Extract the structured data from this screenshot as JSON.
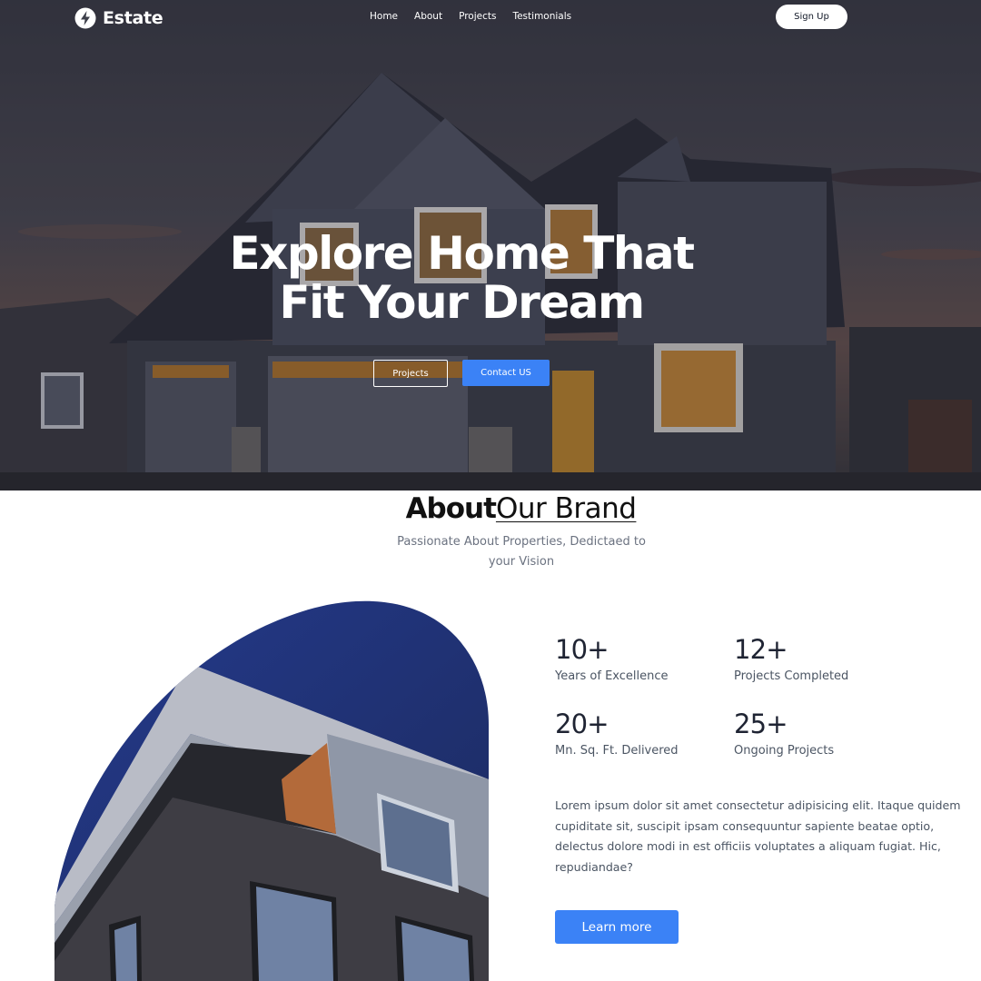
{
  "brand": {
    "name": "Estate",
    "logo_icon": "lightning-bolt-icon"
  },
  "nav": {
    "links": [
      "Home",
      "About",
      "Projects",
      "Testimonials"
    ],
    "signup_label": "Sign Up"
  },
  "hero": {
    "title_line1": "Explore Home That",
    "title_line2": "Fit Your Dream",
    "projects_label": "Projects",
    "contact_label": "Contact US"
  },
  "about": {
    "heading_bold": "About",
    "heading_light": "Our Brand",
    "subtitle": "Passionate About Properties, Dedictaed to your Vision",
    "stats": [
      {
        "value": "10+",
        "label": "Years of Excellence"
      },
      {
        "value": "12+",
        "label": "Projects Completed"
      },
      {
        "value": "20+",
        "label": "Mn. Sq. Ft. Delivered"
      },
      {
        "value": "25+",
        "label": "Ongoing Projects"
      }
    ],
    "body": "Lorem ipsum dolor sit amet consectetur adipisicing elit. Itaque quidem cupiditate sit, suscipit ipsam consequuntur sapiente beatae optio, delectus dolore modi in est officiis voluptates a aliquam fugiat. Hic, repudiandae?",
    "cta_label": "Learn more"
  },
  "colors": {
    "accent": "#3b82f6",
    "text_dark": "#1f2433",
    "text_muted": "#6b7280"
  }
}
